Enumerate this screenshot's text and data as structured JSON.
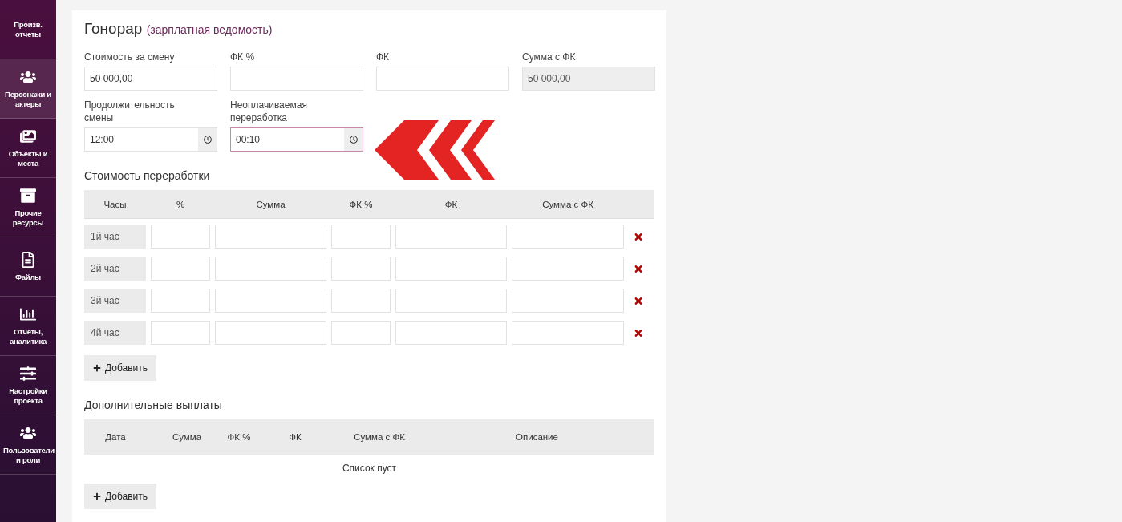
{
  "sidebar": {
    "items": [
      {
        "label": "Произв. отчеты",
        "kind": "plain",
        "selected": false
      },
      {
        "label": "Персонажи и актеры",
        "kind": "people",
        "selected": true
      },
      {
        "label": "Объекты и места",
        "kind": "pictures",
        "selected": false
      },
      {
        "label": "Прочие ресурсы",
        "kind": "box",
        "selected": false
      },
      {
        "label": "Файлы",
        "kind": "document",
        "selected": false
      },
      {
        "label": "Отчеты, аналитика",
        "kind": "chart",
        "selected": false
      },
      {
        "label": "Настройки проекта",
        "kind": "sliders",
        "selected": false
      },
      {
        "label": "Пользователи и роли",
        "kind": "people",
        "selected": false
      }
    ]
  },
  "fee": {
    "title": "Гонорар",
    "subtitle": "(зарплатная ведомость)",
    "fields": [
      {
        "kind": "text",
        "label": "Стоимость за смену",
        "value": "50 000,00",
        "disabled": false,
        "focused": false
      },
      {
        "kind": "text",
        "label": "ФК %",
        "disabled": false,
        "focused": false
      },
      {
        "kind": "text",
        "label": "ФК",
        "disabled": false,
        "focused": false
      },
      {
        "kind": "text",
        "label": "Сумма с ФК",
        "value": "50 000,00",
        "disabled": true,
        "focused": false
      },
      {
        "kind": "time",
        "label": "Продолжительность смены",
        "value": "12:00",
        "disabled": false,
        "focused": false
      },
      {
        "kind": "time",
        "label": "Неоплачиваемая переработка",
        "value": "00:10",
        "disabled": false,
        "focused": true
      }
    ]
  },
  "overtime": {
    "title": "Стоимость переработки",
    "columns": [
      "Часы",
      "%",
      "Сумма",
      "ФК %",
      "ФК",
      "Сумма с ФК"
    ],
    "rows": [
      {
        "hour": "1й час"
      },
      {
        "hour": "2й час"
      },
      {
        "hour": "3й час"
      },
      {
        "hour": "4й час"
      }
    ],
    "add_button": "Добавить"
  },
  "extra": {
    "title": "Дополнительные выплаты",
    "columns": [
      "Дата",
      "Сумма",
      "ФК %",
      "ФК",
      "Сумма с ФК",
      "Описание"
    ],
    "empty": "Список пуст",
    "add_button": "Добавить"
  }
}
